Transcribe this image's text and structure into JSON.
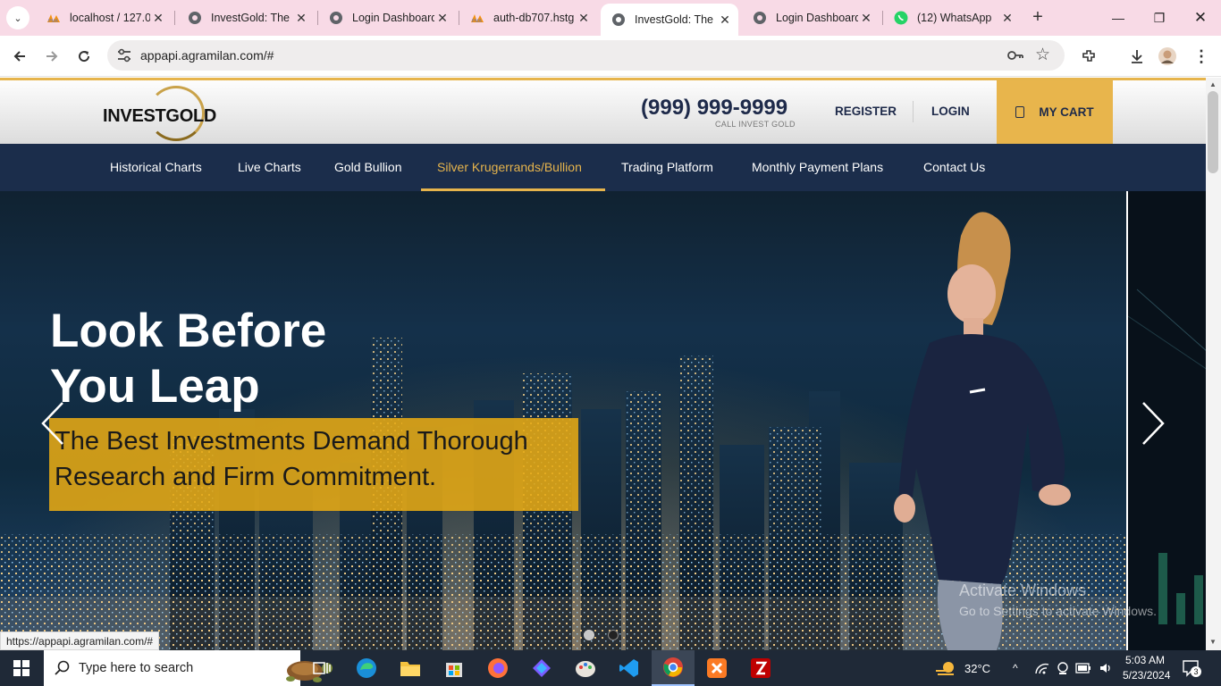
{
  "browser": {
    "tabs": [
      {
        "title": "localhost / 127.0",
        "icon": "phpmyadmin-icon"
      },
      {
        "title": "InvestGold: The",
        "icon": "globe-icon"
      },
      {
        "title": "Login Dashboard",
        "icon": "globe-icon"
      },
      {
        "title": "auth-db707.hstg",
        "icon": "phpmyadmin-icon"
      },
      {
        "title": "InvestGold: The",
        "icon": "globe-icon",
        "active": true
      },
      {
        "title": "Login Dashboard",
        "icon": "globe-icon"
      },
      {
        "title": "(12) WhatsApp",
        "icon": "whatsapp-icon"
      }
    ],
    "url": "appapi.agramilan.com/#",
    "status_url": "https://appapi.agramilan.com/#"
  },
  "site": {
    "logo_text": "INVESTGOLD",
    "phone": "(999) 999-9999",
    "phone_caption": "CALL INVEST GOLD",
    "register_label": "REGISTER",
    "login_label": "LOGIN",
    "cart_label": "MY CART",
    "accent_color": "#e6b44c",
    "nav_color": "#1b2d4b",
    "nav": [
      {
        "label": "Historical Charts"
      },
      {
        "label": "Live Charts"
      },
      {
        "label": "Gold Bullion"
      },
      {
        "label": "Silver Krugerrands/Bullion",
        "active": true
      },
      {
        "label": "Trading Platform"
      },
      {
        "label": "Monthly Payment Plans"
      },
      {
        "label": "Contact Us"
      }
    ],
    "hero": {
      "headline_line1": "Look Before",
      "headline_line2": "You Leap",
      "subtitle_line1": "The Best Investments Demand Thorough",
      "subtitle_line2": "Research and Firm Commitment.",
      "slides": 2,
      "active_slide": 2
    }
  },
  "watermark": {
    "line1": "Activate Windows",
    "line2": "Go to Settings to activate Windows."
  },
  "taskbar": {
    "search_placeholder": "Type here to search",
    "weather": "32°C",
    "time": "5:03 AM",
    "date": "5/23/2024",
    "notification_count": "3"
  }
}
